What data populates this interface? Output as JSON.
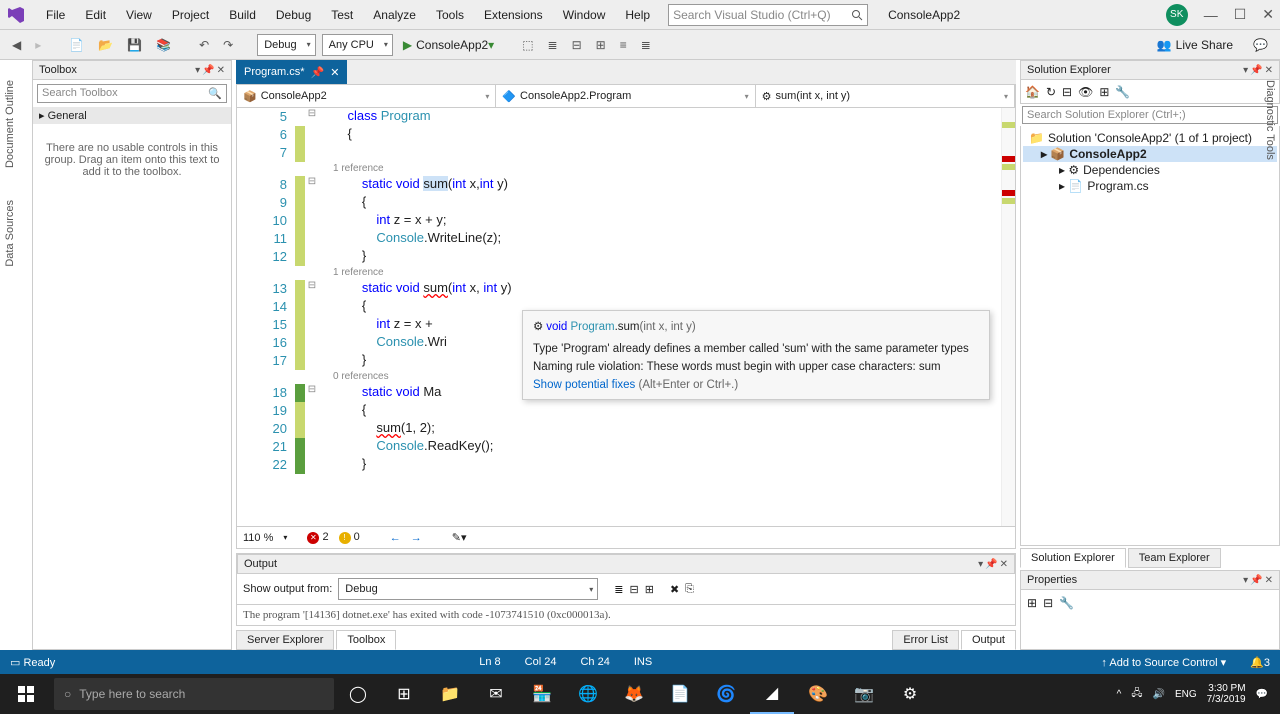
{
  "menubar": {
    "items": [
      "File",
      "Edit",
      "View",
      "Project",
      "Build",
      "Debug",
      "Test",
      "Analyze",
      "Tools",
      "Extensions",
      "Window",
      "Help"
    ]
  },
  "searchPlaceholder": "Search Visual Studio (Ctrl+Q)",
  "solutionName": "ConsoleApp2",
  "userInitials": "SK",
  "toolbar": {
    "config": "Debug",
    "platform": "Any CPU",
    "runTarget": "ConsoleApp2",
    "liveShare": "Live Share"
  },
  "sideTabs": [
    "Document Outline",
    "Data Sources"
  ],
  "toolbox": {
    "title": "Toolbox",
    "search": "Search Toolbox",
    "category": "General",
    "message": "There are no usable controls in this group. Drag an item onto this text to add it to the toolbox."
  },
  "fileTab": "Program.cs*",
  "nav": {
    "project": "ConsoleApp2",
    "class": "ConsoleApp2.Program",
    "member": "sum(int x, int y)"
  },
  "code": {
    "lines": [
      {
        "n": 5,
        "m": "",
        "t": "    class Program"
      },
      {
        "n": 6,
        "m": "y",
        "t": "    {"
      },
      {
        "n": 7,
        "m": "y",
        "t": ""
      },
      {
        "ref": "1 reference"
      },
      {
        "n": 8,
        "m": "y",
        "t": "        static void sum(int x,int y)",
        "hl": "sum"
      },
      {
        "n": 9,
        "m": "y",
        "t": "        {"
      },
      {
        "n": 10,
        "m": "y",
        "t": "            int z = x + y;"
      },
      {
        "n": 11,
        "m": "y",
        "t": "            Console.WriteLine(z);"
      },
      {
        "n": 12,
        "m": "y",
        "t": "        }"
      },
      {
        "ref": "1 reference"
      },
      {
        "n": 13,
        "m": "y",
        "t": "        static void sum(int x, int y)",
        "err": "sum"
      },
      {
        "n": 14,
        "m": "y",
        "t": "        {"
      },
      {
        "n": 15,
        "m": "y",
        "t": "            int z = x +"
      },
      {
        "n": 16,
        "m": "y",
        "t": "            Console.Wri"
      },
      {
        "n": 17,
        "m": "y",
        "t": "        }"
      },
      {
        "ref": "0 references"
      },
      {
        "n": 18,
        "m": "g",
        "t": "        static void Ma"
      },
      {
        "n": 19,
        "m": "y",
        "t": "        {"
      },
      {
        "n": 20,
        "m": "y",
        "t": "            sum(1, 2);",
        "err": "sum"
      },
      {
        "n": 21,
        "m": "g",
        "t": "            Console.ReadKey();"
      },
      {
        "n": 22,
        "m": "g",
        "t": "        }"
      }
    ]
  },
  "tooltip": {
    "sig_void": "void ",
    "sig_class": "Program",
    "sig_method": ".sum",
    "sig_params": "(int x, int y)",
    "msg1": "Type 'Program' already defines a member called 'sum' with the same parameter types",
    "msg2": "Naming rule violation: These words must begin with upper case characters: sum",
    "fix": "Show potential fixes",
    "fixHint": " (Alt+Enter or Ctrl+.)"
  },
  "edstatus": {
    "zoom": "110 %",
    "errors": "2",
    "warnings": "0"
  },
  "output": {
    "title": "Output",
    "from": "Show output from:",
    "source": "Debug",
    "line": "The program '[14136] dotnet.exe' has exited with code -1073741510 (0xc000013a)."
  },
  "bottomTabs": {
    "left": [
      "Server Explorer",
      "Toolbox"
    ],
    "right": [
      "Error List",
      "Output"
    ]
  },
  "solExp": {
    "title": "Solution Explorer",
    "search": "Search Solution Explorer (Ctrl+;)",
    "sln": "Solution 'ConsoleApp2' (1 of 1 project)",
    "proj": "ConsoleApp2",
    "deps": "Dependencies",
    "file": "Program.cs",
    "tabs": [
      "Solution Explorer",
      "Team Explorer"
    ]
  },
  "props": {
    "title": "Properties"
  },
  "statusbar": {
    "ready": "Ready",
    "ln": "Ln 8",
    "col": "Col 24",
    "ch": "Ch 24",
    "ins": "INS",
    "src": "Add to Source Control"
  },
  "taskbar": {
    "search": "Type here to search",
    "lang": "ENG",
    "time": "3:30 PM",
    "date": "7/3/2019"
  }
}
